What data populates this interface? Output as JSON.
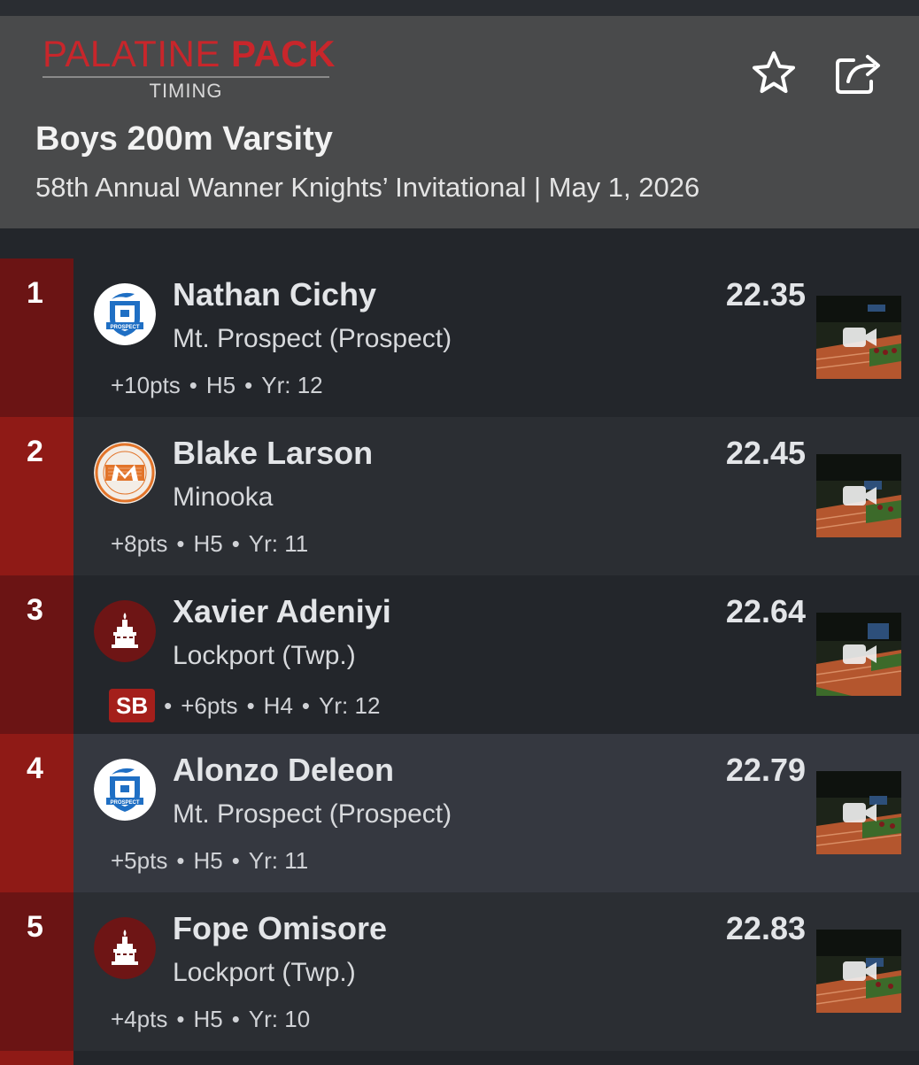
{
  "header": {
    "logo_word1": "PALATINE ",
    "logo_word2": "PACK",
    "logo_sub": "TIMING",
    "title": "Boys 200m Varsity",
    "subtitle": "58th Annual Wanner Knights’ Invitational | May 1, 2026",
    "icons": [
      "star-icon",
      "share-icon"
    ]
  },
  "results": [
    {
      "place": "1",
      "name": "Nathan Cichy",
      "school": "Mt. Prospect (Prospect)",
      "time": "22.35",
      "pts": "+10pts",
      "heat": "H5",
      "yr": "Yr: 12",
      "badge": "",
      "logo": "prospect"
    },
    {
      "place": "2",
      "name": "Blake Larson",
      "school": "Minooka",
      "time": "22.45",
      "pts": "+8pts",
      "heat": "H5",
      "yr": "Yr: 11",
      "badge": "",
      "logo": "minooka"
    },
    {
      "place": "3",
      "name": "Xavier Adeniyi",
      "school": "Lockport (Twp.)",
      "time": "22.64",
      "pts": "+6pts",
      "heat": "H4",
      "yr": "Yr: 12",
      "badge": "SB",
      "logo": "lockport"
    },
    {
      "place": "4",
      "name": "Alonzo Deleon",
      "school": "Mt. Prospect (Prospect)",
      "time": "22.79",
      "pts": "+5pts",
      "heat": "H5",
      "yr": "Yr: 11",
      "badge": "",
      "logo": "prospect"
    },
    {
      "place": "5",
      "name": "Fope Omisore",
      "school": "Lockport (Twp.)",
      "time": "22.83",
      "pts": "+4pts",
      "heat": "H5",
      "yr": "Yr: 10",
      "badge": "",
      "logo": "lockport"
    }
  ],
  "colors": {
    "accent": "#c8262b",
    "place_dark": "#6b1414",
    "place_bright": "#8f1a16",
    "badge": "#a41f1b"
  }
}
